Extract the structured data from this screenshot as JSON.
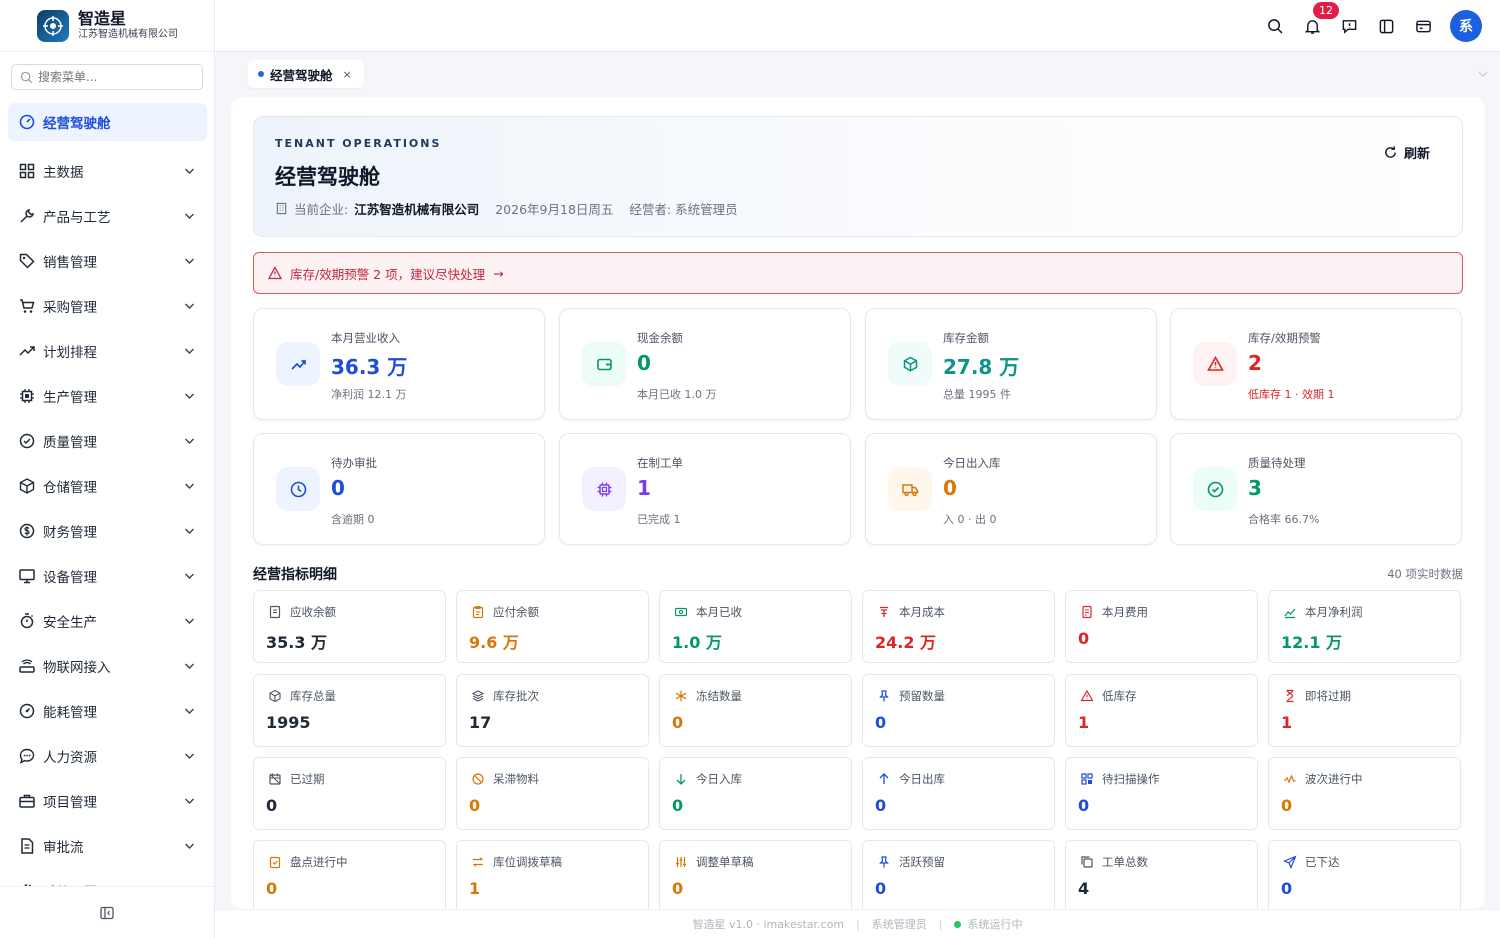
{
  "brand": {
    "name": "智造星",
    "subtitle": "江苏智造机械有限公司"
  },
  "search": {
    "placeholder": "搜索菜单..."
  },
  "nav": [
    {
      "label": "经营驾驶舱",
      "icon": "dashboard-icon",
      "active": true
    },
    {
      "label": "主数据",
      "icon": "grid-icon"
    },
    {
      "label": "产品与工艺",
      "icon": "wrench-icon"
    },
    {
      "label": "销售管理",
      "icon": "tag-icon"
    },
    {
      "label": "采购管理",
      "icon": "cart-icon"
    },
    {
      "label": "计划排程",
      "icon": "trend-icon"
    },
    {
      "label": "生产管理",
      "icon": "chip-icon"
    },
    {
      "label": "质量管理",
      "icon": "check-circle-icon"
    },
    {
      "label": "仓储管理",
      "icon": "box-icon"
    },
    {
      "label": "财务管理",
      "icon": "dollar-icon"
    },
    {
      "label": "设备管理",
      "icon": "monitor-icon"
    },
    {
      "label": "安全生产",
      "icon": "timer-icon"
    },
    {
      "label": "物联网接入",
      "icon": "router-icon"
    },
    {
      "label": "能耗管理",
      "icon": "gauge-icon"
    },
    {
      "label": "人力资源",
      "icon": "chat-icon"
    },
    {
      "label": "项目管理",
      "icon": "briefcase-icon"
    },
    {
      "label": "审批流",
      "icon": "document-icon"
    },
    {
      "label": "系统配置",
      "icon": "gear-icon"
    }
  ],
  "header": {
    "notification_count": "12",
    "avatar_text": "系"
  },
  "tabs": [
    {
      "label": "经营驾驶舱",
      "close": "×"
    }
  ],
  "hero": {
    "kicker": "TENANT OPERATIONS",
    "title": "经营驾驶舱",
    "company_prefix": "当前企业:",
    "company": "江苏智造机械有限公司",
    "date": "2026年9月18日周五",
    "operator": "经营者: 系统管理员",
    "refresh_label": "刷新"
  },
  "alert": {
    "text": "库存/效期预警 2 项，建议尽快处理",
    "arrow": "→"
  },
  "kpis": [
    {
      "label": "本月营业收入",
      "value": "36.3 万",
      "sub": "净利润 12.1 万",
      "color": "#1d4ed8",
      "bg": "#eef4ff",
      "icon": "trend-up-icon"
    },
    {
      "label": "现金余额",
      "value": "0",
      "sub": "本月已收 1.0 万",
      "color": "#059669",
      "bg": "#ecfdf5",
      "icon": "wallet-icon"
    },
    {
      "label": "库存金额",
      "value": "27.8 万",
      "sub": "总量 1995 件",
      "color": "#0d9488",
      "bg": "#effcf9",
      "icon": "cube-icon"
    },
    {
      "label": "库存/效期预警",
      "value": "2",
      "sub": "低库存 1 · 效期 1",
      "color": "#dc2626",
      "bg": "#fef2f2",
      "icon": "warning-icon",
      "sub_color": "#dc2626"
    },
    {
      "label": "待办审批",
      "value": "0",
      "sub": "含逾期 0",
      "color": "#1d4ed8",
      "bg": "#eef4ff",
      "icon": "clock-icon"
    },
    {
      "label": "在制工单",
      "value": "1",
      "sub": "已完成 1",
      "color": "#7c3aed",
      "bg": "#f5f0ff",
      "icon": "cpu-icon"
    },
    {
      "label": "今日出入库",
      "value": "0",
      "sub": "入 0 · 出 0",
      "color": "#d97706",
      "bg": "#fff7ec",
      "icon": "truck-icon"
    },
    {
      "label": "质量待处理",
      "value": "3",
      "sub": "合格率 66.7%",
      "color": "#059669",
      "bg": "#ecfdf5",
      "icon": "check-icon"
    }
  ],
  "section": {
    "title": "经营指标明细",
    "count": "40 项实时数据"
  },
  "metrics": [
    {
      "label": "应收余额",
      "value": "35.3 万",
      "color": "#1f2937",
      "icon": "receipt-icon"
    },
    {
      "label": "应付余额",
      "value": "9.6 万",
      "color": "#d97706",
      "icon": "clipboard-icon"
    },
    {
      "label": "本月已收",
      "value": "1.0 万",
      "color": "#059669",
      "icon": "money-icon"
    },
    {
      "label": "本月成本",
      "value": "24.2 万",
      "color": "#dc2626",
      "icon": "yen-icon"
    },
    {
      "label": "本月费用",
      "value": "0",
      "color": "#dc2626",
      "icon": "bill-icon"
    },
    {
      "label": "本月净利润",
      "value": "12.1 万",
      "color": "#059669",
      "icon": "chart-line-icon"
    },
    {
      "label": "库存总量",
      "value": "1995",
      "color": "#1f2937",
      "icon": "package-icon"
    },
    {
      "label": "库存批次",
      "value": "17",
      "color": "#1f2937",
      "icon": "layers-icon"
    },
    {
      "label": "冻结数量",
      "value": "0",
      "color": "#d97706",
      "icon": "snowflake-icon"
    },
    {
      "label": "预留数量",
      "value": "0",
      "color": "#1d4ed8",
      "icon": "pin-icon"
    },
    {
      "label": "低库存",
      "value": "1",
      "color": "#dc2626",
      "icon": "alert-icon"
    },
    {
      "label": "即将过期",
      "value": "1",
      "color": "#dc2626",
      "icon": "hourglass-icon"
    },
    {
      "label": "已过期",
      "value": "0",
      "color": "#1f2937",
      "icon": "calendar-off-icon"
    },
    {
      "label": "呆滞物料",
      "value": "0",
      "color": "#d97706",
      "icon": "ban-icon"
    },
    {
      "label": "今日入库",
      "value": "0",
      "color": "#059669",
      "icon": "arrow-down-icon"
    },
    {
      "label": "今日出库",
      "value": "0",
      "color": "#1d4ed8",
      "icon": "arrow-up-icon"
    },
    {
      "label": "待扫描操作",
      "value": "0",
      "color": "#1d4ed8",
      "icon": "scan-icon"
    },
    {
      "label": "波次进行中",
      "value": "0",
      "color": "#d97706",
      "icon": "wave-icon"
    },
    {
      "label": "盘点进行中",
      "value": "0",
      "color": "#d97706",
      "icon": "clipboard-check-icon"
    },
    {
      "label": "库位调拨草稿",
      "value": "1",
      "color": "#d97706",
      "icon": "transfer-icon"
    },
    {
      "label": "调整单草稿",
      "value": "0",
      "color": "#d97706",
      "icon": "sliders-icon"
    },
    {
      "label": "活跃预留",
      "value": "0",
      "color": "#1d4ed8",
      "icon": "pin-icon"
    },
    {
      "label": "工单总数",
      "value": "4",
      "color": "#1f2937",
      "icon": "copy-icon"
    },
    {
      "label": "已下达",
      "value": "0",
      "color": "#1d4ed8",
      "icon": "send-icon"
    }
  ],
  "footer": {
    "version": "智造星 v1.0 · imakestar.com",
    "user": "系统管理员",
    "status": "系统运行中"
  }
}
